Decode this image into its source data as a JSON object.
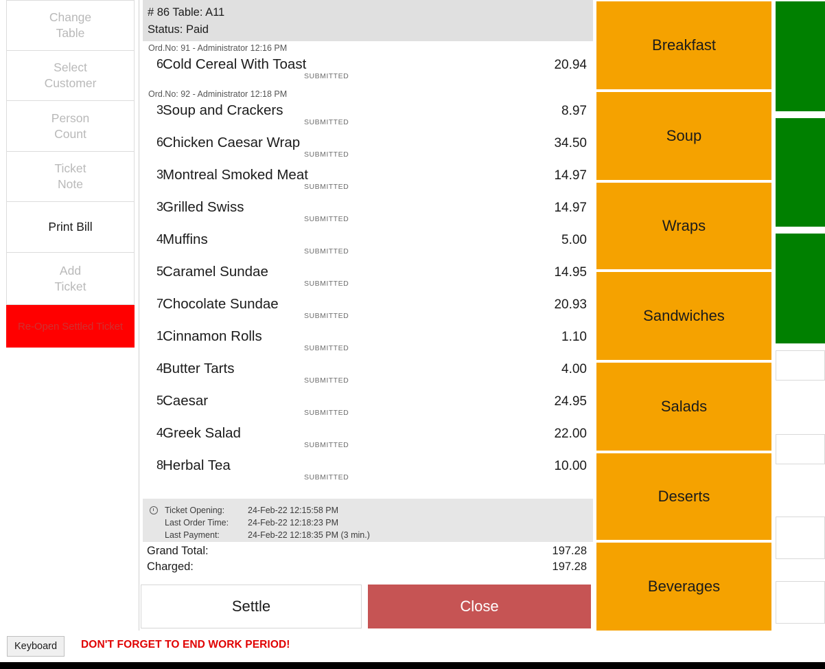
{
  "sidebar": {
    "buttons": [
      {
        "label": "Change\nTable",
        "enabled": false
      },
      {
        "label": "Select\nCustomer",
        "enabled": false
      },
      {
        "label": "Person\nCount",
        "enabled": false
      },
      {
        "label": "Ticket\nNote",
        "enabled": false
      },
      {
        "label": "Print Bill",
        "enabled": true
      },
      {
        "label": "Add\nTicket",
        "enabled": false
      },
      {
        "label": "Re-Open Settled Ticket",
        "enabled": true
      }
    ]
  },
  "ticket": {
    "header": {
      "title": "# 86 Table: A11",
      "status": "Status: Paid"
    },
    "groups": [
      {
        "header": "Ord.No: 91 - Administrator 12:16 PM",
        "lines": [
          {
            "qty": "6",
            "name": "Cold Cereal With Toast",
            "state": "SUBMITTED",
            "amount": "20.94"
          }
        ]
      },
      {
        "header": "Ord.No: 92 - Administrator 12:18 PM",
        "lines": [
          {
            "qty": "3",
            "name": "Soup and Crackers",
            "state": "SUBMITTED",
            "amount": "8.97"
          },
          {
            "qty": "6",
            "name": "Chicken Caesar Wrap",
            "state": "SUBMITTED",
            "amount": "34.50"
          },
          {
            "qty": "3",
            "name": "Montreal Smoked Meat",
            "state": "SUBMITTED",
            "amount": "14.97"
          },
          {
            "qty": "3",
            "name": "Grilled Swiss",
            "state": "SUBMITTED",
            "amount": "14.97"
          },
          {
            "qty": "4",
            "name": "Muffins",
            "state": "SUBMITTED",
            "amount": "5.00"
          },
          {
            "qty": "5",
            "name": "Caramel Sundae",
            "state": "SUBMITTED",
            "amount": "14.95"
          },
          {
            "qty": "7",
            "name": "Chocolate Sundae",
            "state": "SUBMITTED",
            "amount": "20.93"
          },
          {
            "qty": "1",
            "name": "Cinnamon Rolls",
            "state": "SUBMITTED",
            "amount": "1.10"
          },
          {
            "qty": "4",
            "name": "Butter Tarts",
            "state": "SUBMITTED",
            "amount": "4.00"
          },
          {
            "qty": "5",
            "name": "Caesar",
            "state": "SUBMITTED",
            "amount": "24.95"
          },
          {
            "qty": "4",
            "name": "Greek Salad",
            "state": "SUBMITTED",
            "amount": "22.00"
          },
          {
            "qty": "8",
            "name": "Herbal Tea",
            "state": "SUBMITTED",
            "amount": "10.00"
          }
        ]
      }
    ],
    "times": [
      {
        "label": "Ticket Opening:",
        "value": "24-Feb-22 12:15:58 PM"
      },
      {
        "label": "Last Order Time:",
        "value": "24-Feb-22 12:18:23 PM"
      },
      {
        "label": "Last Payment:",
        "value": "24-Feb-22 12:18:35 PM (3 min.)"
      }
    ],
    "totals": [
      {
        "label": "Grand Total:",
        "value": "197.28"
      },
      {
        "label": "Charged:",
        "value": "197.28"
      }
    ],
    "actions": {
      "settle": "Settle",
      "close": "Close"
    }
  },
  "categories": [
    {
      "label": "Breakfast"
    },
    {
      "label": "Soup"
    },
    {
      "label": "Wraps"
    },
    {
      "label": "Sandwiches"
    },
    {
      "label": "Salads"
    },
    {
      "label": "Deserts"
    },
    {
      "label": "Beverages"
    }
  ],
  "tiles": [
    {
      "kind": "green"
    },
    {
      "kind": "green"
    },
    {
      "kind": "green"
    },
    {
      "kind": "white"
    },
    {
      "kind": "white"
    },
    {
      "kind": "white"
    },
    {
      "kind": "white"
    }
  ],
  "bottom": {
    "keyboard_label": "Keyboard",
    "warning": "DON'T FORGET TO END WORK PERIOD!"
  },
  "colors": {
    "category": "#f5a200",
    "reopen": "#ff0000",
    "close": "#c65454",
    "tile_green": "#008000",
    "warning": "#e00000"
  }
}
